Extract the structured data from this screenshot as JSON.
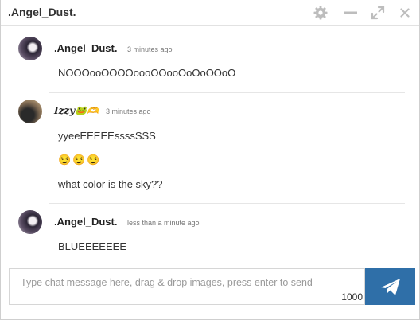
{
  "window": {
    "title": ".Angel_Dust.",
    "controls": {
      "settings_icon": "gear-icon",
      "minimize_icon": "minimize-icon",
      "maximize_icon": "expand-icon",
      "close_icon": "close-icon"
    }
  },
  "messages": [
    {
      "author": ".Angel_Dust.",
      "time": "3 minutes ago",
      "lines": [
        "NOOOooOOOOoooOOooOoOoOOoO"
      ]
    },
    {
      "author": "Izzy🐸🫶",
      "time": "3 minutes ago",
      "lines": [
        "yyeeEEEEEssssSSS",
        "😏😏😏",
        "what color is the sky??"
      ]
    },
    {
      "author": ".Angel_Dust.",
      "time": "less than a minute ago",
      "lines": [
        "BLUEEEEEEE"
      ]
    }
  ],
  "composer": {
    "placeholder": "Type chat message here, drag & drop images, press enter to send",
    "char_limit": "1000",
    "send_icon": "paper-plane-icon"
  },
  "colors": {
    "accent": "#2f6fa8",
    "text": "#333333",
    "timestamp": "#777777",
    "separator": "#e6e6e6"
  }
}
